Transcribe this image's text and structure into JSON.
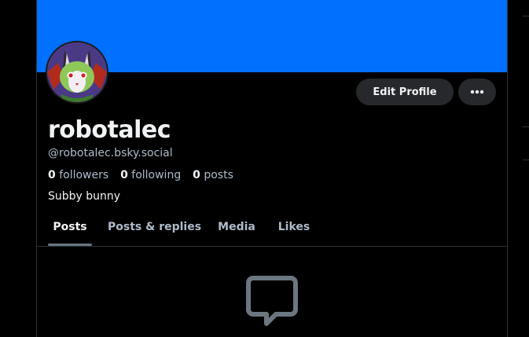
{
  "colors": {
    "banner": "#0070ff",
    "background": "#000000",
    "button_bg": "#26282b",
    "text_primary": "#f1f3f5",
    "text_secondary": "#aebbc9",
    "border": "#2e3438"
  },
  "profile": {
    "display_name": "robotalec",
    "handle": "@robotalec.bsky.social",
    "bio": "Subby bunny",
    "avatar_icon": "bunny-avatar"
  },
  "stats": {
    "followers_count": "0",
    "followers_label": "followers",
    "following_count": "0",
    "following_label": "following",
    "posts_count": "0",
    "posts_label": "posts"
  },
  "actions": {
    "edit_profile_label": "Edit Profile",
    "more_icon": "ellipsis-icon"
  },
  "tabs": [
    {
      "label": "Posts",
      "active": true
    },
    {
      "label": "Posts & replies",
      "active": false
    },
    {
      "label": "Media",
      "active": false
    },
    {
      "label": "Likes",
      "active": false
    }
  ],
  "feed": {
    "empty_icon": "message-bubble-icon"
  }
}
